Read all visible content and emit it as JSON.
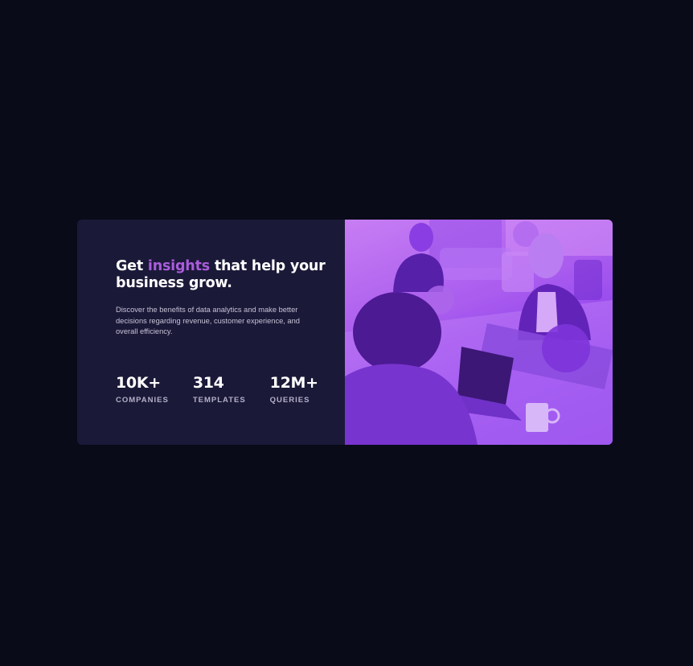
{
  "card": {
    "title_prefix": "Get ",
    "title_accent": "insights",
    "title_suffix": " that help your business grow.",
    "description": "Discover the benefits of data analytics and make better decisions regarding revenue, customer experience, and overall efficiency.",
    "stats": [
      {
        "value": "10K+",
        "label": "COMPANIES"
      },
      {
        "value": "314",
        "label": "TEMPLATES"
      },
      {
        "value": "12M+",
        "label": "QUERIES"
      }
    ],
    "image_name": "office-team-photo",
    "colors": {
      "page_bg": "#090b18",
      "card_bg": "#1b1938",
      "accent": "#aa5cdb",
      "image_tint": "#8c3ef0"
    }
  }
}
